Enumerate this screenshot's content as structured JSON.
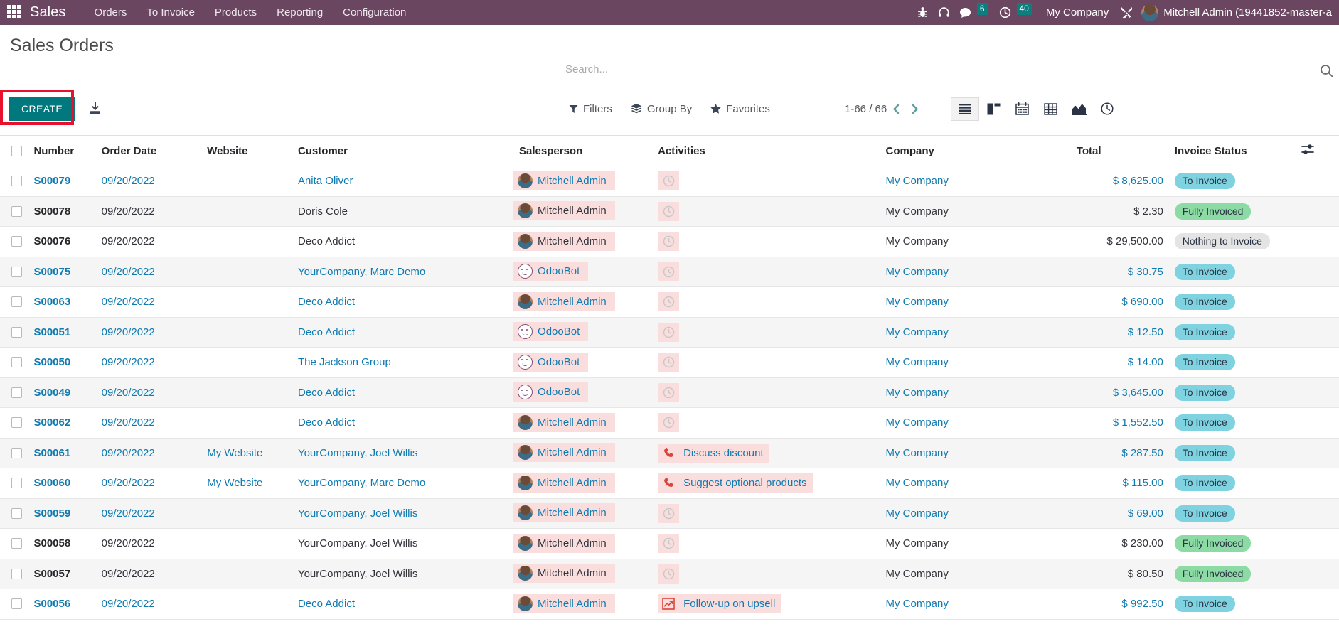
{
  "navbar": {
    "apps_label": "apps-grid",
    "brand": "Sales",
    "menu": [
      {
        "label": "Orders"
      },
      {
        "label": "To Invoice"
      },
      {
        "label": "Products"
      },
      {
        "label": "Reporting"
      },
      {
        "label": "Configuration"
      }
    ],
    "messages_count": "6",
    "activities_count": "40",
    "company": "My Company",
    "user": "Mitchell Admin (19441852-master-a"
  },
  "control_panel": {
    "title": "Sales Orders",
    "create_label": "CREATE",
    "search_placeholder": "Search...",
    "filters_label": "Filters",
    "group_by_label": "Group By",
    "favorites_label": "Favorites",
    "pager": "1-66 / 66",
    "views": [
      {
        "name": "list",
        "active": true
      },
      {
        "name": "kanban",
        "active": false
      },
      {
        "name": "calendar",
        "active": false
      },
      {
        "name": "pivot",
        "active": false
      },
      {
        "name": "graph",
        "active": false
      },
      {
        "name": "activity",
        "active": false
      }
    ]
  },
  "table": {
    "columns": [
      "Number",
      "Order Date",
      "Website",
      "Customer",
      "Salesperson",
      "Activities",
      "Company",
      "Total",
      "Invoice Status"
    ],
    "rows": [
      {
        "number": "S00079",
        "number_link": true,
        "date": "09/20/2022",
        "date_link": true,
        "website": "",
        "customer": "Anita Oliver",
        "customer_link": true,
        "salesperson": "Mitchell Admin",
        "sp_avatar": "photo",
        "sp_link": true,
        "activity_icon": "clock",
        "activity_label": "",
        "company": "My Company",
        "company_link": true,
        "total": "$ 8,625.00",
        "total_link": true,
        "invoice_status": "To Invoice",
        "badge_class": "to-invoice"
      },
      {
        "number": "S00078",
        "number_link": false,
        "date": "09/20/2022",
        "date_link": false,
        "website": "",
        "customer": "Doris Cole",
        "customer_link": false,
        "salesperson": "Mitchell Admin",
        "sp_avatar": "photo",
        "sp_link": false,
        "activity_icon": "clock",
        "activity_label": "",
        "company": "My Company",
        "company_link": false,
        "total": "$ 2.30",
        "total_link": false,
        "invoice_status": "Fully Invoiced",
        "badge_class": "fully-invoiced"
      },
      {
        "number": "S00076",
        "number_link": false,
        "date": "09/20/2022",
        "date_link": false,
        "website": "",
        "customer": "Deco Addict",
        "customer_link": false,
        "salesperson": "Mitchell Admin",
        "sp_avatar": "photo",
        "sp_link": false,
        "activity_icon": "clock",
        "activity_label": "",
        "company": "My Company",
        "company_link": false,
        "total": "$ 29,500.00",
        "total_link": false,
        "invoice_status": "Nothing to Invoice",
        "badge_class": "nothing"
      },
      {
        "number": "S00075",
        "number_link": true,
        "date": "09/20/2022",
        "date_link": true,
        "website": "",
        "customer": "YourCompany, Marc Demo",
        "customer_link": true,
        "salesperson": "OdooBot",
        "sp_avatar": "bot",
        "sp_link": true,
        "activity_icon": "clock",
        "activity_label": "",
        "company": "My Company",
        "company_link": true,
        "total": "$ 30.75",
        "total_link": true,
        "invoice_status": "To Invoice",
        "badge_class": "to-invoice"
      },
      {
        "number": "S00063",
        "number_link": true,
        "date": "09/20/2022",
        "date_link": true,
        "website": "",
        "customer": "Deco Addict",
        "customer_link": true,
        "salesperson": "Mitchell Admin",
        "sp_avatar": "photo",
        "sp_link": true,
        "activity_icon": "clock",
        "activity_label": "",
        "company": "My Company",
        "company_link": true,
        "total": "$ 690.00",
        "total_link": true,
        "invoice_status": "To Invoice",
        "badge_class": "to-invoice"
      },
      {
        "number": "S00051",
        "number_link": true,
        "date": "09/20/2022",
        "date_link": true,
        "website": "",
        "customer": "Deco Addict",
        "customer_link": true,
        "salesperson": "OdooBot",
        "sp_avatar": "bot",
        "sp_link": true,
        "activity_icon": "clock",
        "activity_label": "",
        "company": "My Company",
        "company_link": true,
        "total": "$ 12.50",
        "total_link": true,
        "invoice_status": "To Invoice",
        "badge_class": "to-invoice"
      },
      {
        "number": "S00050",
        "number_link": true,
        "date": "09/20/2022",
        "date_link": true,
        "website": "",
        "customer": "The Jackson Group",
        "customer_link": true,
        "salesperson": "OdooBot",
        "sp_avatar": "bot",
        "sp_link": true,
        "activity_icon": "clock",
        "activity_label": "",
        "company": "My Company",
        "company_link": true,
        "total": "$ 14.00",
        "total_link": true,
        "invoice_status": "To Invoice",
        "badge_class": "to-invoice"
      },
      {
        "number": "S00049",
        "number_link": true,
        "date": "09/20/2022",
        "date_link": true,
        "website": "",
        "customer": "Deco Addict",
        "customer_link": true,
        "salesperson": "OdooBot",
        "sp_avatar": "bot",
        "sp_link": true,
        "activity_icon": "clock",
        "activity_label": "",
        "company": "My Company",
        "company_link": true,
        "total": "$ 3,645.00",
        "total_link": true,
        "invoice_status": "To Invoice",
        "badge_class": "to-invoice"
      },
      {
        "number": "S00062",
        "number_link": true,
        "date": "09/20/2022",
        "date_link": true,
        "website": "",
        "customer": "Deco Addict",
        "customer_link": true,
        "salesperson": "Mitchell Admin",
        "sp_avatar": "photo",
        "sp_link": true,
        "activity_icon": "clock",
        "activity_label": "",
        "company": "My Company",
        "company_link": true,
        "total": "$ 1,552.50",
        "total_link": true,
        "invoice_status": "To Invoice",
        "badge_class": "to-invoice"
      },
      {
        "number": "S00061",
        "number_link": true,
        "date": "09/20/2022",
        "date_link": true,
        "website": "My Website",
        "website_link": true,
        "customer": "YourCompany, Joel Willis",
        "customer_link": true,
        "salesperson": "Mitchell Admin",
        "sp_avatar": "photo",
        "sp_link": true,
        "activity_icon": "phone",
        "activity_label": "Discuss discount",
        "company": "My Company",
        "company_link": true,
        "total": "$ 287.50",
        "total_link": true,
        "invoice_status": "To Invoice",
        "badge_class": "to-invoice"
      },
      {
        "number": "S00060",
        "number_link": true,
        "date": "09/20/2022",
        "date_link": true,
        "website": "My Website",
        "website_link": true,
        "customer": "YourCompany, Marc Demo",
        "customer_link": true,
        "salesperson": "Mitchell Admin",
        "sp_avatar": "photo",
        "sp_link": true,
        "activity_icon": "phone",
        "activity_label": "Suggest optional products",
        "company": "My Company",
        "company_link": true,
        "total": "$ 115.00",
        "total_link": true,
        "invoice_status": "To Invoice",
        "badge_class": "to-invoice"
      },
      {
        "number": "S00059",
        "number_link": true,
        "date": "09/20/2022",
        "date_link": true,
        "website": "",
        "customer": "YourCompany, Joel Willis",
        "customer_link": true,
        "salesperson": "Mitchell Admin",
        "sp_avatar": "photo",
        "sp_link": true,
        "activity_icon": "clock",
        "activity_label": "",
        "company": "My Company",
        "company_link": true,
        "total": "$ 69.00",
        "total_link": true,
        "invoice_status": "To Invoice",
        "badge_class": "to-invoice"
      },
      {
        "number": "S00058",
        "number_link": false,
        "date": "09/20/2022",
        "date_link": false,
        "website": "",
        "customer": "YourCompany, Joel Willis",
        "customer_link": false,
        "salesperson": "Mitchell Admin",
        "sp_avatar": "photo",
        "sp_link": false,
        "activity_icon": "clock",
        "activity_label": "",
        "company": "My Company",
        "company_link": false,
        "total": "$ 230.00",
        "total_link": false,
        "invoice_status": "Fully Invoiced",
        "badge_class": "fully-invoiced"
      },
      {
        "number": "S00057",
        "number_link": false,
        "date": "09/20/2022",
        "date_link": false,
        "website": "",
        "customer": "YourCompany, Joel Willis",
        "customer_link": false,
        "salesperson": "Mitchell Admin",
        "sp_avatar": "photo",
        "sp_link": false,
        "activity_icon": "clock",
        "activity_label": "",
        "company": "My Company",
        "company_link": false,
        "total": "$ 80.50",
        "total_link": false,
        "invoice_status": "Fully Invoiced",
        "badge_class": "fully-invoiced"
      },
      {
        "number": "S00056",
        "number_link": true,
        "date": "09/20/2022",
        "date_link": true,
        "website": "",
        "customer": "Deco Addict",
        "customer_link": true,
        "salesperson": "Mitchell Admin",
        "sp_avatar": "photo",
        "sp_link": true,
        "activity_icon": "chart",
        "activity_label": "Follow-up on upsell",
        "company": "My Company",
        "company_link": true,
        "total": "$ 992.50",
        "total_link": true,
        "invoice_status": "To Invoice",
        "badge_class": "to-invoice"
      }
    ]
  }
}
